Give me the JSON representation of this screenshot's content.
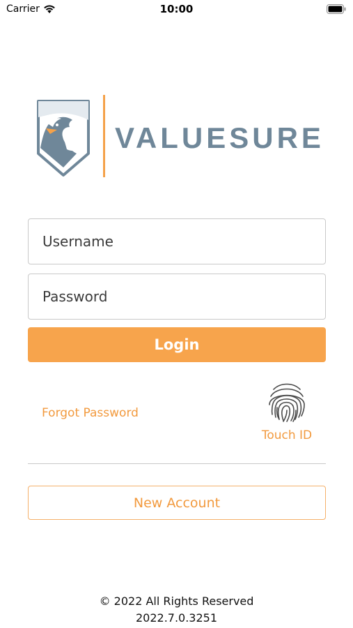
{
  "status_bar": {
    "carrier": "Carrier",
    "time": "10:00",
    "icons": [
      "wifi-icon",
      "battery-icon"
    ]
  },
  "brand": {
    "name": "VALUESURE",
    "text_color": "#6f8799",
    "accent_color": "#f5a24a"
  },
  "login_form": {
    "username_placeholder": "Username",
    "username_value": "",
    "password_placeholder": "Password",
    "password_value": "",
    "login_label": "Login",
    "login_color": "#f7a44c"
  },
  "links": {
    "forgot_password": "Forgot Password",
    "touch_id": "Touch ID",
    "touch_id_icon": "fingerprint-icon"
  },
  "new_account": {
    "label": "New Account"
  },
  "footer": {
    "copyright": "© 2022 All Rights Reserved",
    "version": "2022.7.0.3251"
  }
}
